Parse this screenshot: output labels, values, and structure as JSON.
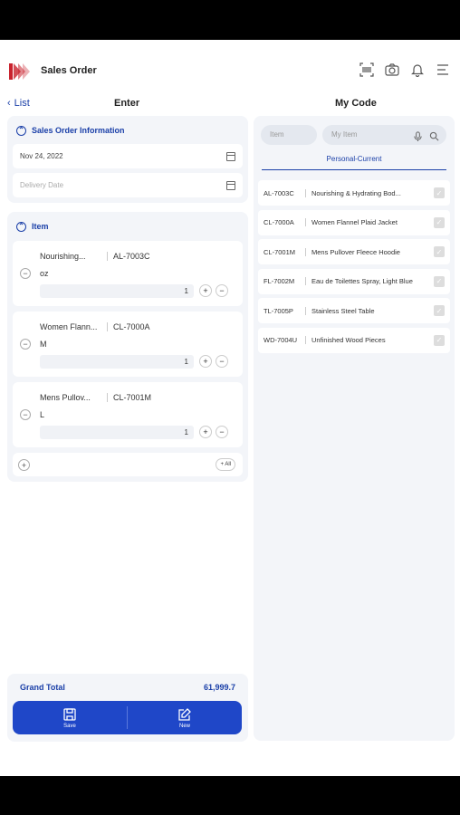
{
  "header": {
    "title": "Sales Order"
  },
  "subbar": {
    "back_label": "List",
    "left_title": "Enter",
    "right_title": "My Code"
  },
  "order_info": {
    "section_title": "Sales Order Information",
    "order_date": "Nov 24, 2022",
    "delivery_placeholder": "Delivery Date"
  },
  "items": {
    "section_title": "Item",
    "rows": [
      {
        "name": "Nourishing...",
        "code": "AL-7003C",
        "size": "oz",
        "qty": "1"
      },
      {
        "name": "Women Flann...",
        "code": "CL-7000A",
        "size": "M",
        "qty": "1"
      },
      {
        "name": "Mens Pullov...",
        "code": "CL-7001M",
        "size": "L",
        "qty": "1"
      }
    ],
    "all_label": "+ All"
  },
  "total": {
    "label": "Grand Total",
    "value": "61,999.7"
  },
  "actions": {
    "save_label": "Save",
    "new_label": "New"
  },
  "right_panel": {
    "item_placeholder": "Item",
    "code_placeholder": "My Item",
    "tab_label": "Personal-Current",
    "codes": [
      {
        "code": "AL-7003C",
        "desc": "Nourishing & Hydrating Bod..."
      },
      {
        "code": "CL-7000A",
        "desc": "Women Flannel Plaid Jacket"
      },
      {
        "code": "CL-7001M",
        "desc": "Mens Pullover Fleece Hoodie"
      },
      {
        "code": "FL-7002M",
        "desc": "Eau de Toilettes Spray, Light Blue"
      },
      {
        "code": "TL-7005P",
        "desc": "Stainless Steel Table"
      },
      {
        "code": "WD-7004U",
        "desc": "Unfinished Wood Pieces"
      }
    ]
  },
  "colors": {
    "accent": "#1f47c8",
    "panel": "#f3f5f9",
    "logo": "#c9232e"
  }
}
